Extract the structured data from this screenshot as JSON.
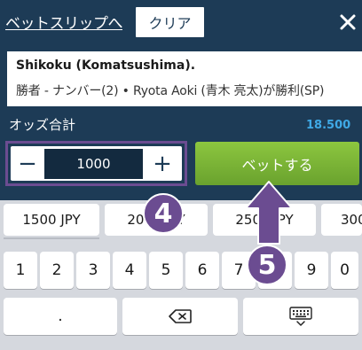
{
  "header": {
    "betslip_link": "ベットスリップへ",
    "clear_label": "クリア",
    "close_icon": "close-icon"
  },
  "bet": {
    "event": "Shikoku (Komatsushima).",
    "selection": "勝者 - ナンバー(2) • Ryota Aoki (青木 亮太)が勝利(SP)"
  },
  "odds": {
    "label": "オッズ合計",
    "value": "18.500"
  },
  "stake": {
    "minus_label": "−",
    "amount": "1000",
    "plus_label": "+"
  },
  "place_bet_label": "ベットする",
  "quick_amounts": [
    "1500 JPY",
    "2000 JPY",
    "2500 JPY",
    "300"
  ],
  "keyboard": {
    "digits": [
      "1",
      "2",
      "3",
      "4",
      "5",
      "6",
      "7",
      "8",
      "9",
      "0"
    ],
    "dot": ".",
    "backspace_icon": "backspace-icon",
    "keyboard_icon": "keyboard-icon"
  },
  "annotations": {
    "step_4": "4",
    "step_5": "5"
  },
  "colors": {
    "header_bg": "#1d3b56",
    "accent_green": "#7bb536",
    "odds_blue": "#3fa9e6",
    "annotation_purple": "#6b4c91"
  }
}
